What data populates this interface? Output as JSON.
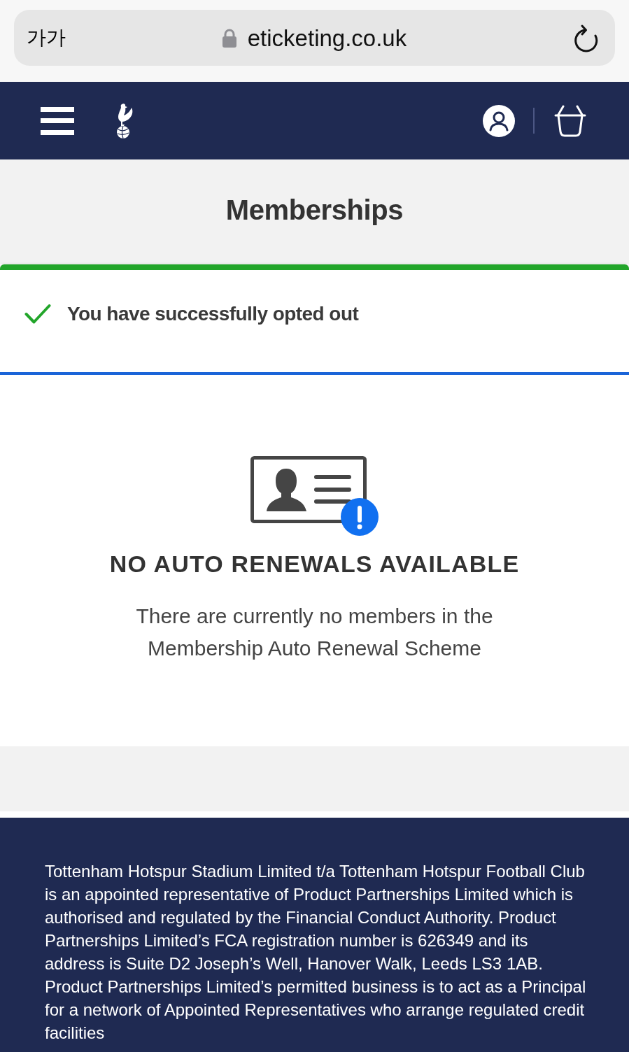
{
  "browser": {
    "text_size_label": "가가",
    "url": "eticketing.co.uk"
  },
  "page_title": "Memberships",
  "alert": {
    "kind": "success",
    "message": "You have successfully opted out"
  },
  "empty_state": {
    "heading": "NO AUTO RENEWALS AVAILABLE",
    "message": "There are currently no members in the Membership Auto Renewal Scheme"
  },
  "footer": {
    "disclaimer": "Tottenham Hotspur Stadium Limited t/a Tottenham Hotspur Football Club is an appointed representative of Product Partnerships Limited which is authorised and regulated by the Financial Conduct Authority. Product Partnerships Limited’s FCA registration number is 626349 and its address is Suite D2 Joseph’s Well, Hanover Walk, Leeds LS3 1AB. Product Partnerships Limited’s permitted business is to act as a Principal for a network of Appointed Representatives who arrange regulated credit facilities"
  }
}
